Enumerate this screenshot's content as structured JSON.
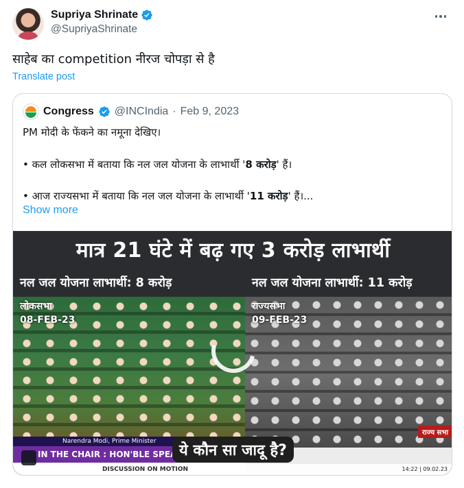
{
  "tweet": {
    "author_name": "Supriya Shrinate",
    "author_handle": "@SupriyaShrinate",
    "text": "साहेब का competition नीरज चोपड़ा से है",
    "translate_label": "Translate post"
  },
  "quoted": {
    "author_name": "Congress",
    "author_handle": "@INCIndia",
    "separator": "·",
    "date": "Feb 9, 2023",
    "line1": "PM मोदी के फेंकने का नमूना देखिए।",
    "line2_prefix": "• कल लोकसभा में बताया कि नल जल योजना के लाभार्थी '",
    "line2_bold": "8 करोड़",
    "line2_suffix": "' हैं।",
    "line3_prefix": "• आज राज्यसभा में बताया कि नल जल योजना के लाभार्थी '",
    "line3_bold": "11 करोड़",
    "line3_suffix": "' हैं।...",
    "show_more_label": "Show more"
  },
  "media": {
    "headline": "मात्र 21 घंटे में बढ़ गए 3 करोड़ लाभार्थी",
    "left_caption": "नल जल योजना लाभार्थी: 8 करोड़",
    "right_caption": "नल जल योजना लाभार्थी: 11 करोड़",
    "left_house": "लोकसभा",
    "left_date": "08-FEB-23",
    "right_house": "राज्यसभा",
    "right_date": "09-FEB-23",
    "speaker_name": "Narendra Modi, Prime Minister",
    "chair_text": "IN THE CHAIR : HON'BLE SPEAK",
    "motion_text": "DISCUSSION ON MOTION",
    "rs_badge": "राज्य सभा",
    "rs_timestamp": "14:22 | 09.02.23",
    "question": "ये कौन सा जादू है?"
  },
  "colors": {
    "link": "#1d9bf0",
    "verified": "#1d9bf0",
    "secondary_text": "#536471"
  }
}
